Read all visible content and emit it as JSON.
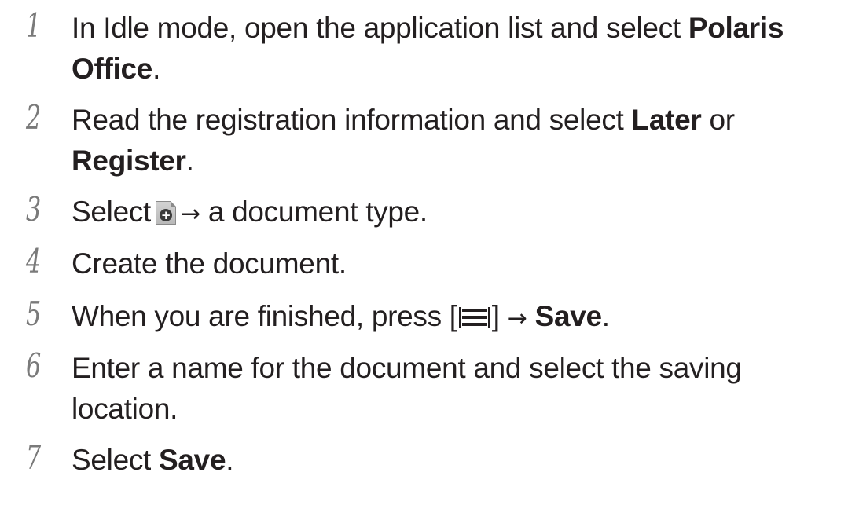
{
  "steps": [
    {
      "number": "1",
      "line1_text": "In Idle mode, open the application list and select ",
      "line1_bold": "Polaris",
      "line2_bold": "Office",
      "line2_text": "."
    },
    {
      "number": "2",
      "line1_text": "Read the registration information and select ",
      "line1_bold": "Later",
      "line1_after": " or",
      "line2_bold": "Register",
      "line2_text": "."
    },
    {
      "number": "3",
      "before_icon": "Select",
      "icon": "new-document-icon",
      "arrow": "→",
      "after_icon": " a document type."
    },
    {
      "number": "4",
      "text": "Create the document."
    },
    {
      "number": "5",
      "before_key": "When you are finished, press [",
      "key_icon": "menu-key-icon",
      "after_key": "]",
      "arrow": "→",
      "bold": "Save",
      "end": "."
    },
    {
      "number": "6",
      "line1_text": "Enter a name for the document and select the saving",
      "line2_text": "location."
    },
    {
      "number": "7",
      "text": "Select ",
      "bold": "Save",
      "end": "."
    }
  ]
}
